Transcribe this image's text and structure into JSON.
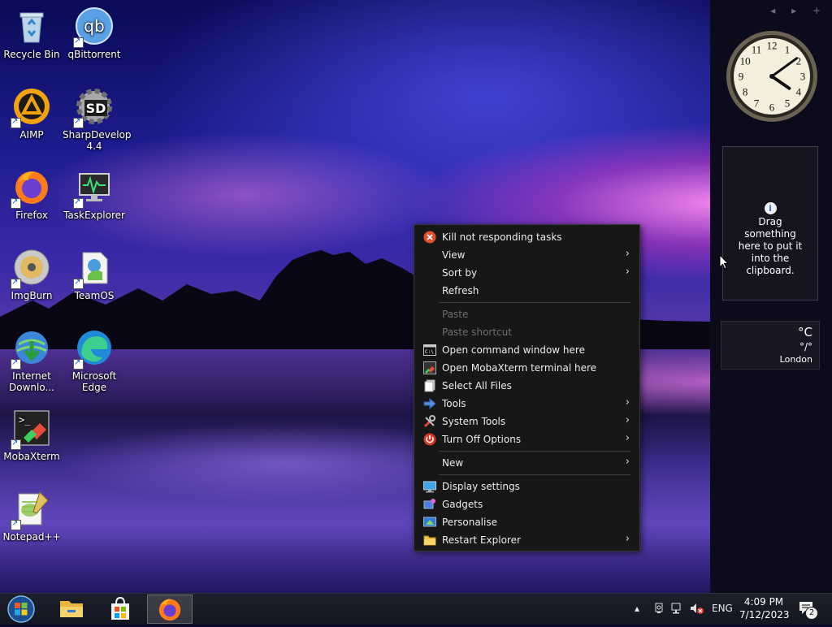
{
  "desktop": {
    "icons": [
      {
        "label": "Recycle Bin"
      },
      {
        "label": "qBittorrent"
      },
      {
        "label": "AIMP"
      },
      {
        "label": "SharpDevelop 4.4"
      },
      {
        "label": "Firefox"
      },
      {
        "label": "TaskExplorer"
      },
      {
        "label": "ImgBurn"
      },
      {
        "label": "TeamOS"
      },
      {
        "label": "Internet Downlo..."
      },
      {
        "label": "Microsoft Edge"
      },
      {
        "label": "MobaXterm"
      },
      {
        "label": "Notepad++"
      }
    ]
  },
  "context_menu": {
    "items": [
      {
        "label": "Kill not responding tasks",
        "icon": "close-circle-icon"
      },
      {
        "label": "View",
        "submenu": true
      },
      {
        "label": "Sort by",
        "submenu": true
      },
      {
        "label": "Refresh"
      },
      {
        "label": "Paste",
        "disabled": true
      },
      {
        "label": "Paste shortcut",
        "disabled": true
      },
      {
        "label": "Open command window here",
        "icon": "cmd-icon"
      },
      {
        "label": "Open MobaXterm terminal here",
        "icon": "mobaxterm-icon"
      },
      {
        "label": "Select All Files",
        "icon": "select-files-icon"
      },
      {
        "label": "Tools",
        "icon": "arrow-right-icon",
        "submenu": true
      },
      {
        "label": "System Tools",
        "icon": "wrench-icon",
        "submenu": true
      },
      {
        "label": "Turn Off Options",
        "icon": "power-icon",
        "submenu": true
      },
      {
        "label": "New",
        "submenu": true
      },
      {
        "label": "Display settings",
        "icon": "monitor-icon"
      },
      {
        "label": "Gadgets",
        "icon": "gadgets-icon"
      },
      {
        "label": "Personalise",
        "icon": "personalise-icon"
      },
      {
        "label": "Restart Explorer",
        "icon": "folder-icon",
        "submenu": true
      }
    ]
  },
  "sidebar": {
    "controls": "◂ ▸ +",
    "clock": {
      "hour": 4,
      "minute": 9
    },
    "clipboard": {
      "info_glyph": "i",
      "text": "Drag something here to put it into the clipboard."
    },
    "weather": {
      "temp": "°C",
      "range": "°/°",
      "city": "London"
    }
  },
  "taskbar": {
    "tray": {
      "language": "ENG",
      "time": "4:09 PM",
      "date": "7/12/2023",
      "notifications": "2"
    }
  },
  "colors": {
    "menu_bg": "#171717",
    "taskbar_bg": "#131520",
    "sidebar_bg": "#0c0b1b"
  }
}
